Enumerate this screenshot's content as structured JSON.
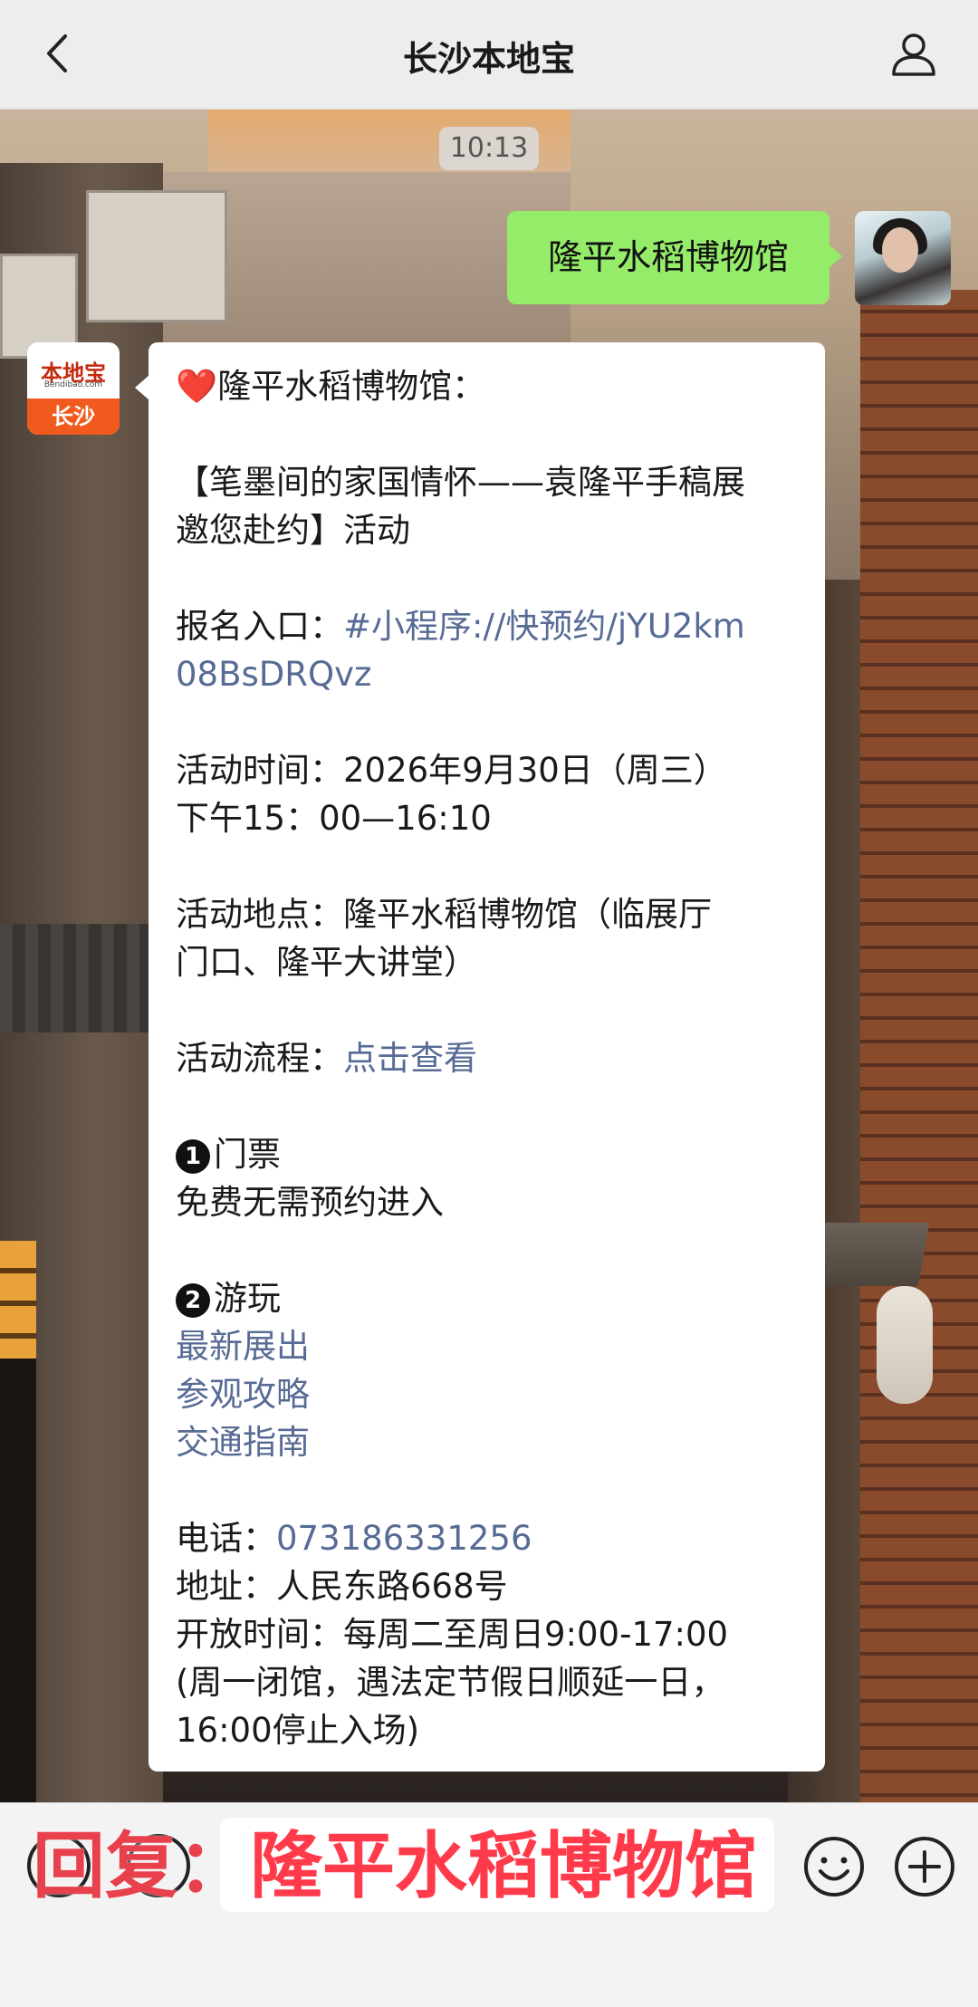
{
  "header": {
    "title": "长沙本地宝",
    "back_icon": "chevron-left-icon",
    "profile_icon": "person-icon"
  },
  "chat": {
    "timestamp": "10:13",
    "sent_message": "隆平水稻博物馆",
    "bot_avatar": {
      "brand": "本地宝",
      "sub": "Bendibao.com",
      "city": "长沙"
    },
    "reply": {
      "heading": "隆平水稻博物馆：",
      "event_line1": "【笔墨间的家国情怀——袁隆平手稿展",
      "event_line2": "邀您赴约】活动",
      "signup_label": "报名入口：",
      "signup_link_1": "#小程序://快预约/jYU2km",
      "signup_link_2": "08BsDRQvz",
      "time_line1": "活动时间：2026年9月30日（周三）",
      "time_line2": "下午15：00—16:10",
      "place_line1": "活动地点：隆平水稻博物馆（临展厅",
      "place_line2": "门口、隆平大讲堂）",
      "flow_label": "活动流程：",
      "flow_link": "点击查看",
      "ticket_num": "1",
      "ticket_title": "门票",
      "ticket_text": "免费无需预约进入",
      "play_num": "2",
      "play_title": "游玩",
      "play_links": [
        "最新展出",
        "参观攻略",
        "交通指南"
      ],
      "phone_label": "电话：",
      "phone": "073186331256",
      "address": "地址：人民东路668号",
      "hours_line1": "开放时间：每周二至周日9:00-17:00",
      "hours_line2": "(周一闭馆，遇法定节假日顺延一日，",
      "hours_line3": "16:00停止入场)"
    }
  },
  "bottom": {
    "overlay_prefix": "回复：",
    "overlay_text": "隆平水稻博物馆"
  },
  "colors": {
    "sent_bubble": "#95ec69",
    "link": "#576b95",
    "overlay_red": "#ff3a4a"
  }
}
